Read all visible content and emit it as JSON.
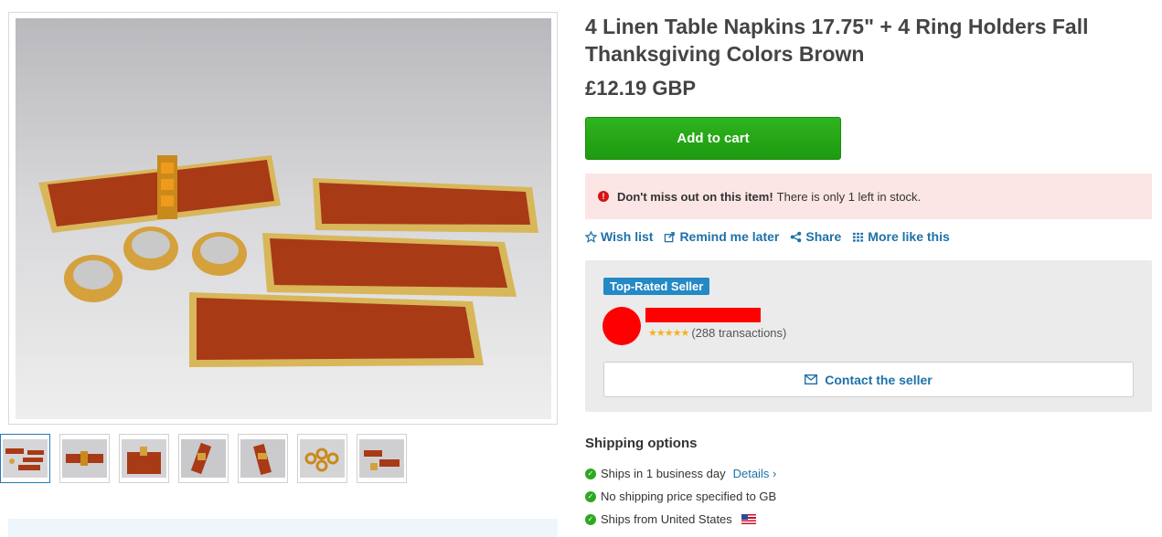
{
  "product": {
    "title": "4 Linen Table Napkins 17.75\" + 4 Ring Holders Fall Thanksgiving Colors Brown",
    "price": "£12.19 GBP",
    "add_to_cart_label": "Add to cart"
  },
  "stock_alert": {
    "bold": "Don't miss out on this item!",
    "text": "There is only 1 left in stock.",
    "icon": "exclamation-icon"
  },
  "actions": [
    {
      "label": "Wish list",
      "icon": "star-icon"
    },
    {
      "label": "Remind me later",
      "icon": "share-arrow-icon"
    },
    {
      "label": "Share",
      "icon": "share-nodes-icon"
    },
    {
      "label": "More like this",
      "icon": "grid-icon"
    }
  ],
  "seller": {
    "badge": "Top-Rated Seller",
    "rating_stars": "★★★★★",
    "transactions": "(288 transactions)",
    "contact_label": "Contact the seller"
  },
  "shipping": {
    "title": "Shipping options",
    "items": [
      {
        "text": "Ships in 1 business day",
        "link": "Details ›"
      },
      {
        "text": "No shipping price specified to GB"
      },
      {
        "text": "Ships from United States"
      }
    ]
  },
  "gallery": {
    "thumbnail_count": 7
  },
  "colors": {
    "accent_link": "#1e71a8",
    "cart_green": "#1e9a10",
    "badge_blue": "#2489c5",
    "alert_bg": "#fbe5e5",
    "napkin_brown": "#a83a16",
    "gold_trim": "#d8b65a"
  }
}
